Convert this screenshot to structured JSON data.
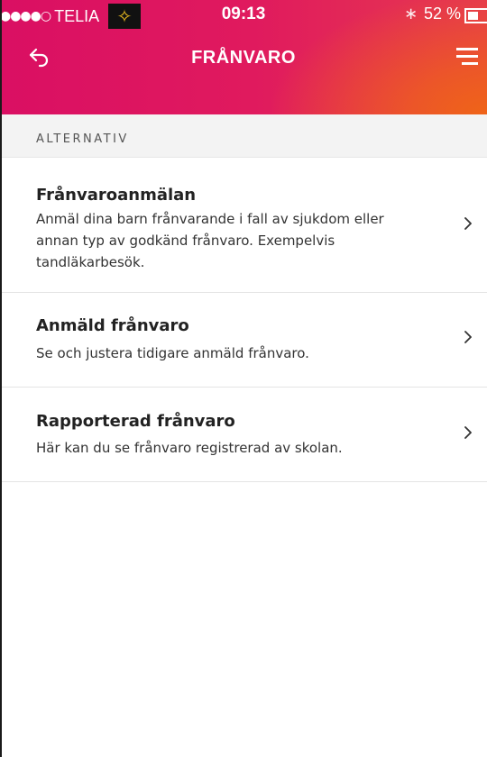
{
  "status_bar": {
    "signal_dots": "●●●●○",
    "carrier": "TELIA",
    "app_badge_icon": "running-figure-icon",
    "time": "09:13",
    "bluetooth_icon": "bluetooth-icon",
    "battery_percent": "52 %",
    "battery_level": 0.52
  },
  "nav": {
    "title": "FRÅNVARO",
    "back_icon": "back-arrow-icon",
    "menu_icon": "hamburger-menu-icon"
  },
  "section": {
    "label": "ALTERNATIV"
  },
  "items": [
    {
      "title": "Frånvaroanmälan",
      "description": "Anmäl dina barn frånvarande i fall av sjukdom eller annan typ av godkänd frånvaro. Exempelvis tandläkarbesök."
    },
    {
      "title": "Anmäld frånvaro",
      "description": "Se och justera tidigare anmäld frånvaro."
    },
    {
      "title": "Rapporterad frånvaro",
      "description": "Här kan du se frånvaro registrerad av skolan."
    }
  ],
  "colors": {
    "header_gradient_start": "#da0f63",
    "header_gradient_end": "#ef6418",
    "section_background": "#f3f3f3",
    "text_primary": "#222222",
    "divider": "#e4e4e4"
  }
}
